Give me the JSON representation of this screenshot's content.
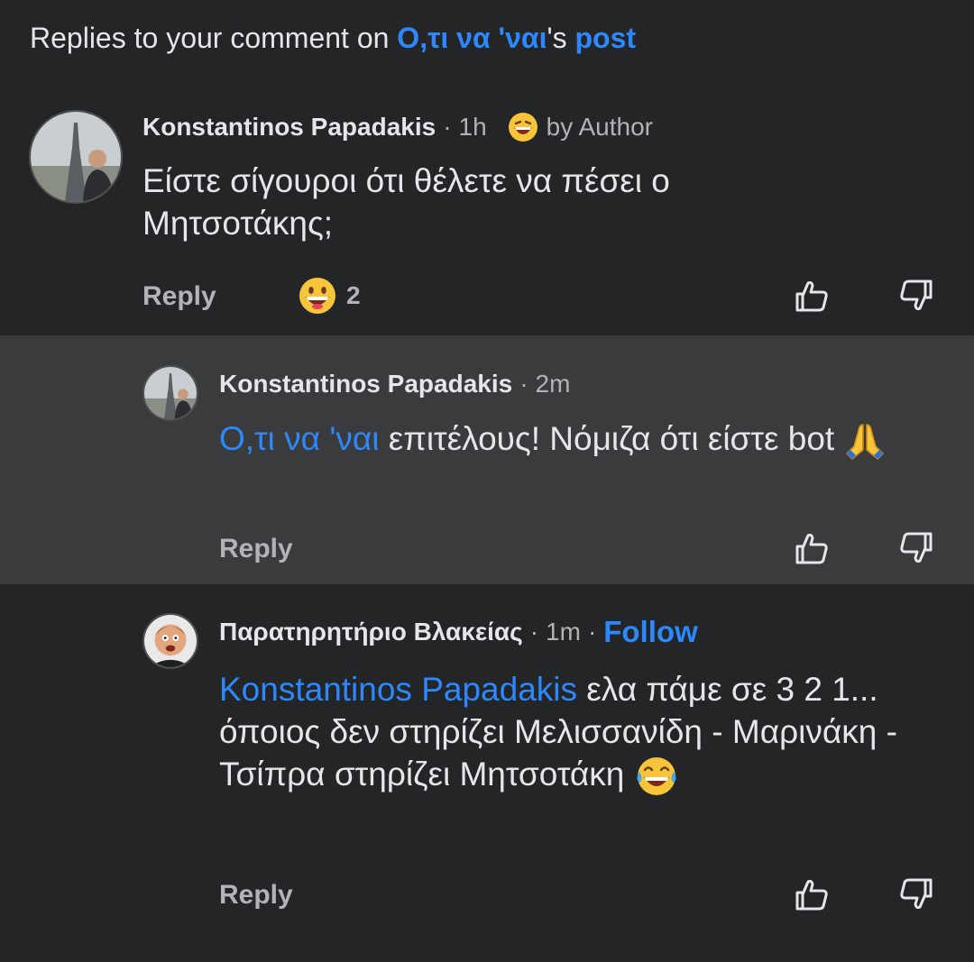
{
  "header": {
    "prefix": "Replies to your comment on ",
    "page_name": "Ο,τι να 'ναι",
    "possessive": "'s ",
    "post_link": "post"
  },
  "comments": [
    {
      "author": "Konstantinos Papadakis",
      "time": "1h",
      "badge": "by Author",
      "text": "Είστε σίγουροι ότι θέλετε να πέσει ο Μητσοτάκης;",
      "reply_label": "Reply",
      "reaction_icon": "grinning-face-icon",
      "reaction_count": "2"
    },
    {
      "author": "Konstantinos Papadakis",
      "time": "2m",
      "mention": "Ο,τι να 'ναι",
      "text": " επιτέλους! Νόμιζα ότι είστε bot ",
      "end_icon": "folded-hands-icon",
      "reply_label": "Reply"
    },
    {
      "author": "Παρατηρητήριο Βλακείας",
      "time": "1m",
      "follow_label": "Follow",
      "mention": "Konstantinos Papadakis",
      "text": " ελα πάμε σε 3 2 1... όποιος δεν στηρίζει Μελισσανίδη - Μαρινάκη - Τσίπρα στηρίζει Μητσοτάκη ",
      "end_icon": "tears-of-joy-icon",
      "reply_label": "Reply"
    }
  ],
  "colors": {
    "background": "#242526",
    "highlight": "#3a3b3c",
    "link": "#2d88ff",
    "text": "#e4e6eb",
    "secondary": "#b0b3b8"
  }
}
